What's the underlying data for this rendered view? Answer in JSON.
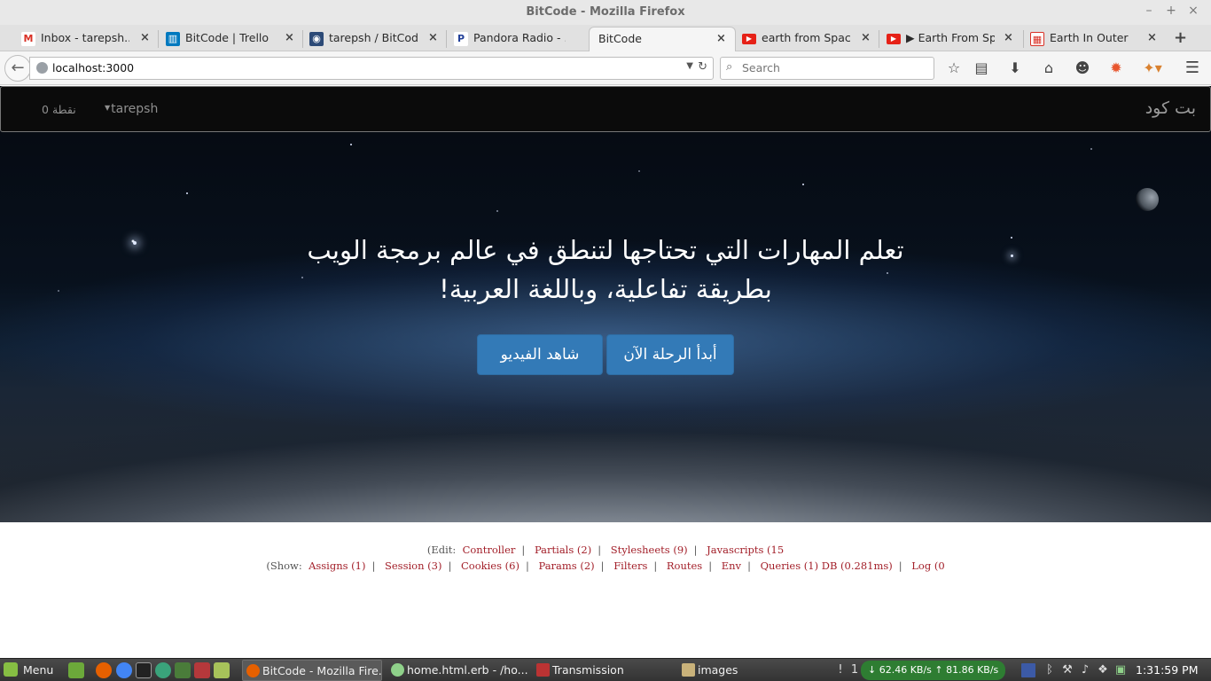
{
  "window": {
    "title": "BitCode - Mozilla Firefox"
  },
  "tabs": [
    {
      "title": "Inbox - tarepsh...",
      "icon": "gmail-icon",
      "color": "#d93025",
      "glyph": "M"
    },
    {
      "title": "BitCode | Trello",
      "icon": "trello-icon",
      "color": "#0079bf",
      "glyph": "▥"
    },
    {
      "title": "tarepsh / BitCod...",
      "icon": "github-icon",
      "color": "#2c4a77",
      "glyph": "◉"
    },
    {
      "title": "Pandora Radio - ...",
      "icon": "pandora-icon",
      "color": "#224099",
      "glyph": "P"
    },
    {
      "title": "BitCode",
      "icon": "bitcode-icon",
      "color": "",
      "glyph": ""
    },
    {
      "title": "earth from Spac...",
      "icon": "youtube-icon",
      "color": "#e62117",
      "glyph": "▶"
    },
    {
      "title": "▶ Earth From Sp...",
      "icon": "youtube-icon",
      "color": "#e62117",
      "glyph": "▶"
    },
    {
      "title": "Earth In Outer S...",
      "icon": "images-icon",
      "color": "#d93025",
      "glyph": "▦"
    }
  ],
  "toolbar": {
    "url": "localhost:3000",
    "search_placeholder": "Search"
  },
  "site": {
    "brand": "بت كود",
    "username": "tarepsh",
    "points": "0 نقطة",
    "headline_line1": "تعلم المهارات التي تحتاجها لتنطق في عالم برمجة الويب",
    "headline_line2": "بطريقة تفاعلية، وباللغة العربية!",
    "start_button": "أبدأ الرحلة الآن",
    "video_button": "شاهد الفيديو"
  },
  "debug": {
    "edit_prefix": "(Edit:",
    "edit_links": [
      "Controller",
      "Partials (2)",
      "Stylesheets (9)",
      "Javascripts (15"
    ],
    "show_prefix": "(Show:",
    "show_links": [
      "Assigns (1)",
      "Session (3)",
      "Cookies (6)",
      "Params (2)",
      "Filters",
      "Routes",
      "Env",
      "Queries (1) DB (0.281ms)",
      "Log (0"
    ]
  },
  "taskbar": {
    "menu_label": "Menu",
    "tasks": [
      {
        "label": "BitCode - Mozilla Fire...",
        "icon": "firefox-icon"
      },
      {
        "label": "home.html.erb - /ho...",
        "icon": "editor-icon"
      },
      {
        "label": "Transmission",
        "icon": "transmission-icon"
      },
      {
        "label": "images",
        "icon": "folder-icon"
      }
    ],
    "notification_count": "1",
    "netspeed": "↓ 62.46 KB/s ↑ 81.86 KB/s",
    "clock": "1:31:59 PM"
  }
}
